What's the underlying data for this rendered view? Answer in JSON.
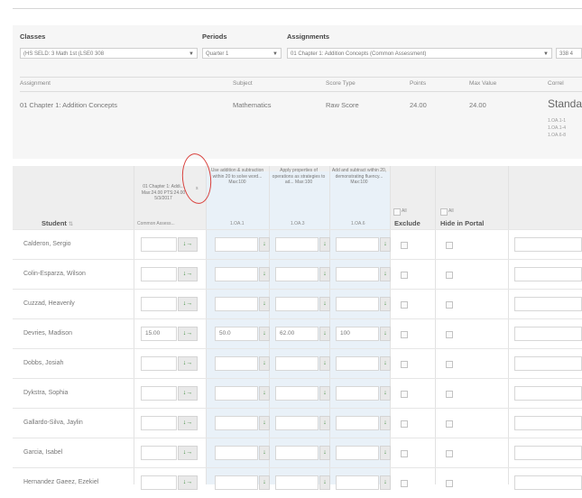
{
  "filters": {
    "classes_label": "Classes",
    "classes_value": "(HS SELD: 3 Math 1st (LSE0 308",
    "periods_label": "Periods",
    "periods_value": "Quarter 1",
    "assignments_label": "Assignments",
    "assignments_value": "01 Chapter 1: Addition Concepts (Common Assessment)",
    "extra_value": "338 4"
  },
  "assignment_table": {
    "headers": [
      "Assignment",
      "Subject",
      "Score Type",
      "Points",
      "Max Value",
      "Correl"
    ],
    "row": {
      "assignment": "01 Chapter 1: Addition Concepts",
      "subject": "Mathematics",
      "score_type": "Raw Score",
      "points": "24.00",
      "max_value": "24.00",
      "standards_label": "Standards",
      "standards_list": [
        "1.OA.1-1",
        "1.OA.1-4",
        "1.OA.6-8"
      ]
    }
  },
  "grid": {
    "student_header": "Student",
    "col_assign": {
      "title": "01 Chapter 1: Addi... Max:24.00 PTS:24.00 5/3/2017",
      "footer": "Common Assess..."
    },
    "col_standard1": {
      "title": "Use addition & subtraction within 20 to solve word... Max:100",
      "footer": "1.OA.1"
    },
    "col_standard2": {
      "title": "Apply properties of operations as strategies to ad... Max:100",
      "footer": "1.OA.3"
    },
    "col_standard3": {
      "title": "Add and subtract within 20, demonstrating fluency... Max:100",
      "footer": "1.OA.6"
    },
    "collapse_marker": "s",
    "all_label": "All",
    "exclude_label": "Exclude",
    "hide_label": "Hide in Portal",
    "arrow_down": "↓",
    "arrow_right": "→"
  },
  "students": [
    {
      "name": "Calderon, Sergio",
      "score": "",
      "s1": "",
      "s2": "",
      "s3": ""
    },
    {
      "name": "Colin-Esparza, Wilson",
      "score": "",
      "s1": "",
      "s2": "",
      "s3": ""
    },
    {
      "name": "Cuzzad, Heavenly",
      "score": "",
      "s1": "",
      "s2": "",
      "s3": ""
    },
    {
      "name": "Devries, Madison",
      "score": "15.00",
      "s1": "50.0",
      "s2": "62.00",
      "s3": "100"
    },
    {
      "name": "Dobbs, Josiah",
      "score": "",
      "s1": "",
      "s2": "",
      "s3": ""
    },
    {
      "name": "Dykstra, Sophia",
      "score": "",
      "s1": "",
      "s2": "",
      "s3": ""
    },
    {
      "name": "Gallardo-Silva, Jaylin",
      "score": "",
      "s1": "",
      "s2": "",
      "s3": ""
    },
    {
      "name": "Garcia, Isabel",
      "score": "",
      "s1": "",
      "s2": "",
      "s3": ""
    },
    {
      "name": "Hernandez Gaeez, Ezekiel",
      "score": "",
      "s1": "",
      "s2": "",
      "s3": ""
    }
  ]
}
